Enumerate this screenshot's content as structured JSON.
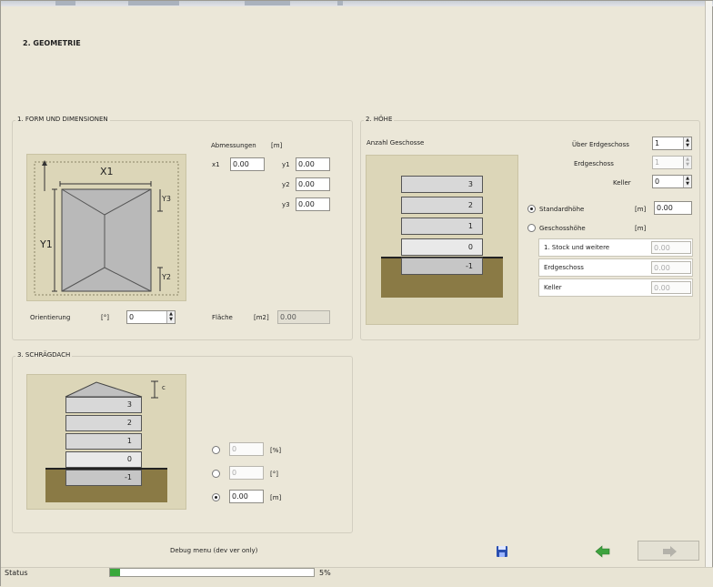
{
  "page": {
    "title": "2.  GEOMETRIE"
  },
  "form_section": {
    "title": "1. FORM UND DIMENSIONEN",
    "dimensions_label": "Abmessungen",
    "dimensions_unit": "[m]",
    "diagram_labels": {
      "x1": "X1",
      "y1": "Y1",
      "y2": "Y2",
      "y3": "Y3"
    },
    "fields": [
      {
        "label": "x1",
        "value": "0.00"
      },
      {
        "label": "y1",
        "value": "0.00"
      },
      {
        "label": "y2",
        "value": "0.00"
      },
      {
        "label": "y3",
        "value": "0.00"
      }
    ],
    "orientation_label": "Orientierung",
    "orientation_unit": "[°]",
    "orientation_value": "0",
    "area_label": "Fläche",
    "area_unit": "[m2]",
    "area_value": "0.00"
  },
  "height_section": {
    "title": "2. HÖHE",
    "floors_label": "Anzahl Geschosse",
    "floor_labels": [
      "3",
      "2",
      "1",
      "0",
      "-1"
    ],
    "counts": [
      {
        "label": "Über Erdgeschoss",
        "value": "1",
        "enabled": true
      },
      {
        "label": "Erdgeschoss",
        "value": "1",
        "enabled": false
      },
      {
        "label": "Keller",
        "value": "0",
        "enabled": true
      }
    ],
    "standard_height_label": "Standardhöhe",
    "standard_height_unit": "[m]",
    "standard_height_value": "0.00",
    "storey_height_label": "Geschosshöhe",
    "storey_height_unit": "[m]",
    "storey_rows": [
      {
        "label": "1. Stock und weitere",
        "value": "0.00"
      },
      {
        "label": "Erdgeschoss",
        "value": "0.00"
      },
      {
        "label": "Keller",
        "value": "0.00"
      }
    ]
  },
  "roof_section": {
    "title": "3. SCHRÄGDACH",
    "diagram_label": "c",
    "floor_labels": [
      "3",
      "2",
      "1",
      "0",
      "-1"
    ],
    "options": [
      {
        "value": "0",
        "unit": "[%]",
        "selected": false
      },
      {
        "value": "0",
        "unit": "[°]",
        "selected": false
      },
      {
        "value": "0.00",
        "unit": "[m]",
        "selected": true
      }
    ]
  },
  "footer": {
    "debug_label": "Debug menu (dev ver only)",
    "status_label": "Status",
    "progress": 5,
    "progress_text": "5%"
  },
  "colors": {
    "background": "#ebe7d8",
    "illustration_bg": "#dcd6b8",
    "soil": "#8a7a45",
    "progress": "#39a83a",
    "back_arrow": "#3ea33e",
    "save_icon": "#2a4fb0"
  },
  "icons": [
    "save-icon",
    "back-arrow-icon",
    "forward-arrow-icon"
  ]
}
